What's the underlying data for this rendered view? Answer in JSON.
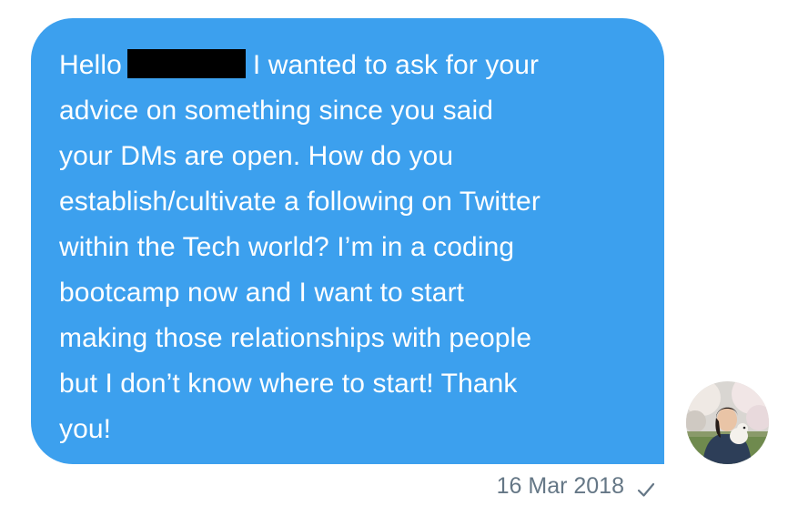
{
  "message": {
    "greeting": "Hello",
    "lines": [
      "I wanted to ask for your",
      "advice on something since you said",
      "your DMs are open. How do you",
      "establish/cultivate a following on Twitter",
      "within the Tech world? I’m in a coding",
      "bootcamp now and I want to start",
      "making those relationships with people",
      "but I don’t know where to start! Thank",
      "you!"
    ],
    "timestamp": "16 Mar 2018",
    "status_icon": "check-icon"
  },
  "colors": {
    "bubble": "#3ca0ee",
    "text": "#ffffff",
    "meta": "#657786",
    "redaction": "#000000"
  }
}
